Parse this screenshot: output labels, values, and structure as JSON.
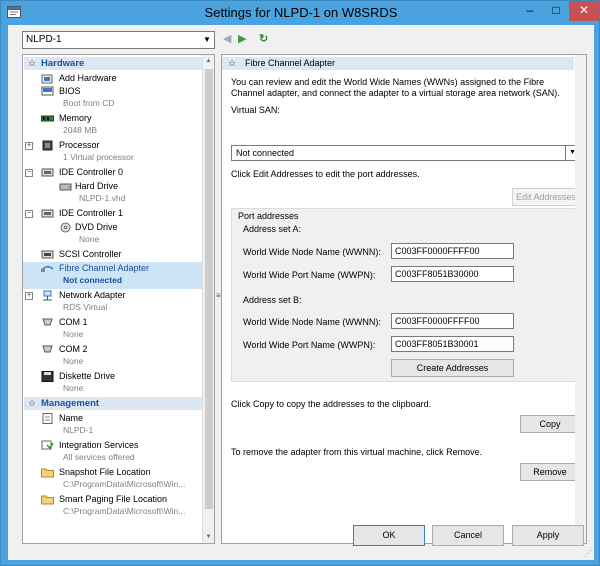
{
  "window": {
    "title": "Settings for NLPD-1 on W8SRDS",
    "minimize_label": "–",
    "maximize_label": "□",
    "close_label": "✕"
  },
  "vm_selector": {
    "value": "NLPD-1",
    "arrow": "▼"
  },
  "nav": {
    "back": "◀",
    "forward": "▶",
    "refresh": "↻"
  },
  "sections": {
    "hardware": {
      "label": "Hardware",
      "chev": "☆"
    },
    "management": {
      "label": "Management",
      "chev": "☆"
    }
  },
  "hardware_items": [
    {
      "label": "Add Hardware",
      "sub": "",
      "icon": "add-hardware-icon"
    },
    {
      "label": "BIOS",
      "sub": "Boot from CD",
      "icon": "bios-icon"
    },
    {
      "label": "Memory",
      "sub": "2048 MB",
      "icon": "memory-icon"
    },
    {
      "label": "Processor",
      "sub": "1 Virtual processor",
      "icon": "processor-icon"
    },
    {
      "label": "IDE Controller 0",
      "sub": "",
      "icon": "ide-controller-icon"
    },
    {
      "label": "Hard Drive",
      "sub": "NLPD-1.vhd",
      "icon": "hard-drive-icon"
    },
    {
      "label": "IDE Controller 1",
      "sub": "",
      "icon": "ide-controller-icon"
    },
    {
      "label": "DVD Drive",
      "sub": "None",
      "icon": "dvd-drive-icon"
    },
    {
      "label": "SCSI Controller",
      "sub": "",
      "icon": "scsi-controller-icon"
    },
    {
      "label": "Fibre Channel Adapter",
      "sub": "Not connected",
      "icon": "fibre-channel-icon"
    },
    {
      "label": "Network Adapter",
      "sub": "RDS Virtual",
      "icon": "network-adapter-icon"
    },
    {
      "label": "COM 1",
      "sub": "None",
      "icon": "com-port-icon"
    },
    {
      "label": "COM 2",
      "sub": "None",
      "icon": "com-port-icon"
    },
    {
      "label": "Diskette Drive",
      "sub": "None",
      "icon": "diskette-icon"
    }
  ],
  "management_items": [
    {
      "label": "Name",
      "sub": "NLPD-1",
      "icon": "name-icon"
    },
    {
      "label": "Integration Services",
      "sub": "All services offered",
      "icon": "integration-services-icon"
    },
    {
      "label": "Snapshot File Location",
      "sub": "C:\\ProgramData\\Microsoft\\Win...",
      "icon": "folder-icon"
    },
    {
      "label": "Smart Paging File Location",
      "sub": "C:\\ProgramData\\Microsoft\\Win...",
      "icon": "folder-icon"
    }
  ],
  "panel": {
    "header": "Fibre Channel Adapter",
    "intro": "You can review and edit the World Wide Names (WWNs) assigned to the Fibre Channel adapter, and connect the adapter to a virtual storage area network (SAN).",
    "virtual_san_label": "Virtual SAN:",
    "virtual_san_value": "Not connected",
    "edit_hint": "Click Edit Addresses to edit the port addresses.",
    "edit_button": "Edit Addresses",
    "port_addresses_label": "Port addresses",
    "set_a_label": "Address set A:",
    "set_b_label": "Address set B:",
    "wwnn_label": "World Wide Node Name (WWNN):",
    "wwpn_label": "World Wide Port Name (WWPN):",
    "set_a_wwnn": "C003FF0000FFFF00",
    "set_a_wwpn": "C003FF8051B30000",
    "set_b_wwnn": "C003FF0000FFFF00",
    "set_b_wwpn": "C003FF8051B30001",
    "create_button": "Create Addresses",
    "copy_hint": "Click Copy to copy the addresses to the clipboard.",
    "copy_button": "Copy",
    "remove_hint": "To remove the adapter from this virtual machine, click Remove.",
    "remove_button": "Remove"
  },
  "footer": {
    "ok": "OK",
    "cancel": "Cancel",
    "apply": "Apply"
  },
  "colors": {
    "window_frame": "#4aa3df",
    "selection": "#cde4f7",
    "section_header": "#dde7f3",
    "link_blue": "#1e4f9b"
  }
}
